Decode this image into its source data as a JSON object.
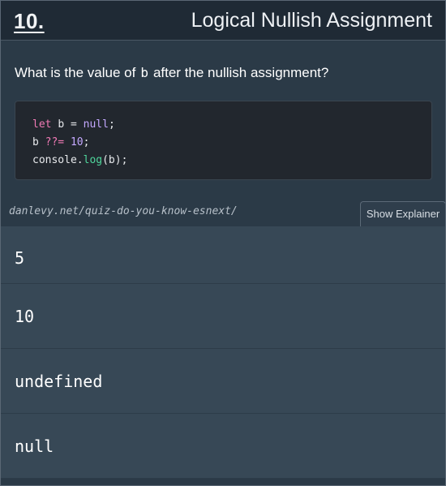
{
  "header": {
    "number": "10.",
    "title": "Logical Nullish Assignment"
  },
  "question": {
    "prefix": "What is the value of",
    "variable": "b",
    "suffix": "after the nullish assignment?"
  },
  "code": {
    "line1": {
      "kw": "let",
      "id": "b",
      "op": "=",
      "lit": "null",
      "end": ";"
    },
    "line2": {
      "id": "b",
      "op": "??=",
      "lit": "10",
      "end": ";"
    },
    "line3": {
      "obj": "console.",
      "fn": "log",
      "args": "(b);"
    }
  },
  "source_link": "danlevy.net/quiz-do-you-know-esnext/",
  "explainer_button": "Show Explainer",
  "answers": [
    "5",
    "10",
    "undefined",
    "null"
  ],
  "colors": {
    "background": "#2b3a47",
    "header": "#1f2a35",
    "code_bg": "#22272e",
    "keyword": "#f07ab5",
    "literal": "#c4a8ff",
    "function": "#4fd69c",
    "answer_bg": "#374856"
  }
}
